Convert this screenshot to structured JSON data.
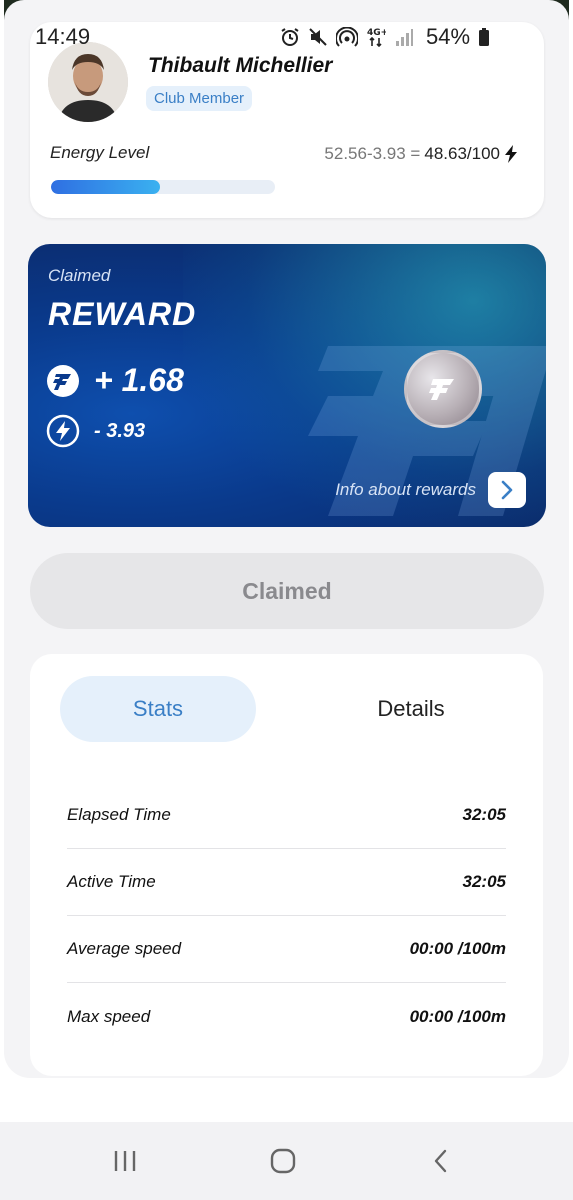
{
  "status_bar": {
    "time": "14:49",
    "battery": "54%",
    "network": "4G+"
  },
  "profile": {
    "name": "Thibault Michellier",
    "badge": "Club Member",
    "energy_label": "Energy Level",
    "energy_formula_a": "52.56-3.93 =",
    "energy_formula_b": "48.63/100",
    "energy_fraction": 0.4863
  },
  "reward": {
    "claimed_label": "Claimed",
    "title": "REWARD",
    "amount": "+ 1.68",
    "energy_change": "- 3.93",
    "info_link": "Info about rewards"
  },
  "claimed_button": "Claimed",
  "tabs": {
    "stats": "Stats",
    "details": "Details"
  },
  "stats": [
    {
      "label": "Elapsed Time",
      "value": "32:05"
    },
    {
      "label": "Active Time",
      "value": "32:05"
    },
    {
      "label": "Average speed",
      "value": "00:00 /100m"
    },
    {
      "label": "Max speed",
      "value": "00:00 /100m"
    }
  ],
  "colors": {
    "accent_blue": "#3a7fc6",
    "badge_bg": "#e5f0fb",
    "card_dark": "#0a3a8c"
  },
  "icons": {
    "alarm": "alarm-icon",
    "mute": "mute-icon",
    "hotspot": "hotspot-icon",
    "signal": "signal-icon",
    "battery": "battery-icon",
    "bolt": "bolt-icon",
    "coin": "coin-icon",
    "chevron": "chevron-right-icon"
  }
}
